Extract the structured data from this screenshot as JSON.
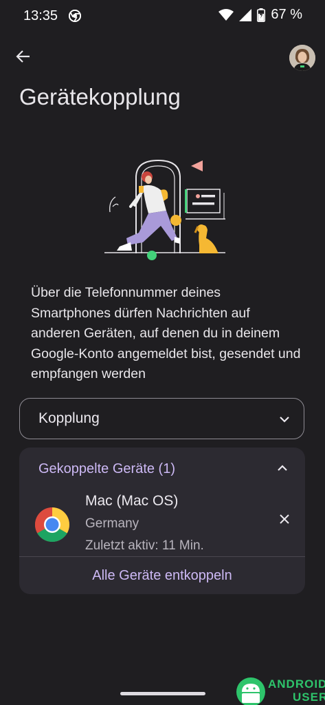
{
  "status_bar": {
    "time": "13:35",
    "battery": "67 %",
    "icons": [
      "chrome-icon",
      "wifi-icon",
      "signal-icon",
      "battery-icon"
    ]
  },
  "top_bar": {
    "back_icon": "arrow-back-icon",
    "avatar": "account-avatar"
  },
  "page": {
    "title": "Gerätekopplung",
    "description": "Über die Telefonnummer deines Smartphones dürfen Nachrichten auf anderen Geräten, auf denen du in deinem Google-Konto angemeldet bist, gesendet und empfangen werden"
  },
  "pairing": {
    "label": "Kopplung",
    "icon": "chevron-down-icon"
  },
  "paired_devices": {
    "header": "Gekoppelte Geräte (1)",
    "header_icon": "chevron-up-icon",
    "devices": [
      {
        "name": "Mac (Mac OS)",
        "location": "Germany",
        "last_active": "Zuletzt aktiv: 11 Min.",
        "icon": "chrome-icon"
      }
    ],
    "unpair_all": "Alle Geräte entkoppeln"
  },
  "watermark": {
    "line1": "ANDROID",
    "line2": "USER"
  },
  "colors": {
    "background": "#1f1e21",
    "card": "#2c2a31",
    "accent": "#cdb9f5",
    "watermark": "#2ec46b"
  }
}
